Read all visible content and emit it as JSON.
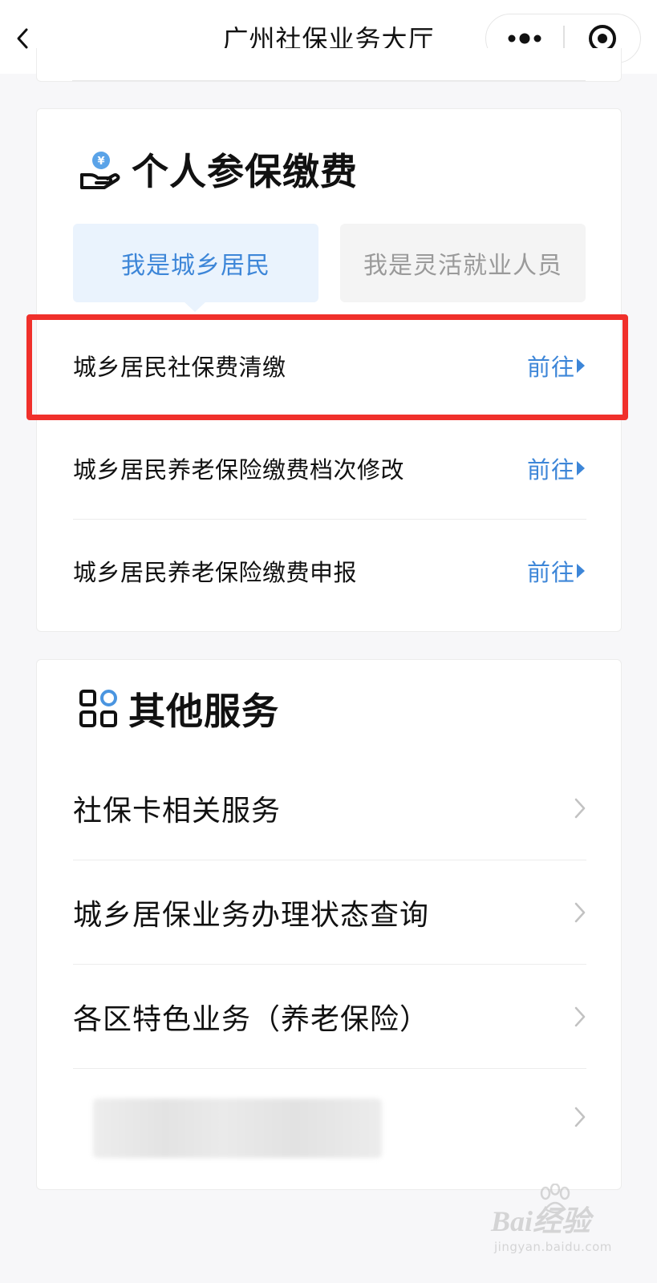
{
  "navbar": {
    "title": "广州社保业务大厅"
  },
  "personal": {
    "title": "个人参保缴费",
    "tabs": [
      {
        "label": "我是城乡居民",
        "active": true
      },
      {
        "label": "我是灵活就业人员",
        "active": false
      }
    ],
    "items": [
      {
        "label": "城乡居民社保费清缴",
        "action": "前往",
        "highlighted": true
      },
      {
        "label": "城乡居民养老保险缴费档次修改",
        "action": "前往"
      },
      {
        "label": "城乡居民养老保险缴费申报",
        "action": "前往"
      }
    ]
  },
  "other": {
    "title": "其他服务",
    "items": [
      {
        "label": "社保卡相关服务"
      },
      {
        "label": "城乡居保业务办理状态查询"
      },
      {
        "label": "各区特色业务（养老保险）"
      },
      {
        "label": ""
      }
    ]
  },
  "watermark": {
    "brand": "Bai经验",
    "site": "jingyan.baidu.com"
  },
  "colors": {
    "accent": "#3d86d8",
    "highlight": "#f0302b",
    "tab_active_bg": "#eaf3fd",
    "tab_inactive_bg": "#f4f4f4"
  }
}
